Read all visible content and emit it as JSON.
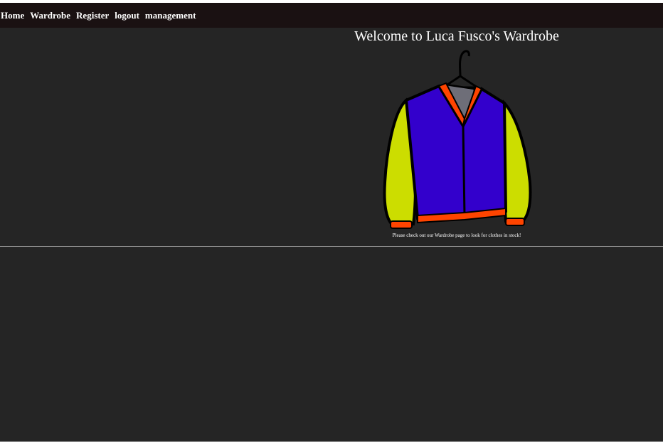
{
  "nav": {
    "items": [
      {
        "label": "Home"
      },
      {
        "label": "Wardrobe"
      },
      {
        "label": "Register"
      },
      {
        "label": "logout"
      },
      {
        "label": "management"
      }
    ]
  },
  "hero": {
    "title": "Welcome to Luca Fusco's Wardrobe",
    "caption": "Please check out our Wardrobe page to look for clothes in stock!",
    "image_icon": "jacket-on-hanger-icon"
  },
  "colors": {
    "page_background": "#252525",
    "navbar_background": "#1a1112",
    "text": "#ffffff",
    "jacket_body": "#3300cc",
    "jacket_sleeves": "#ccdd00",
    "jacket_trim": "#ff4400"
  }
}
